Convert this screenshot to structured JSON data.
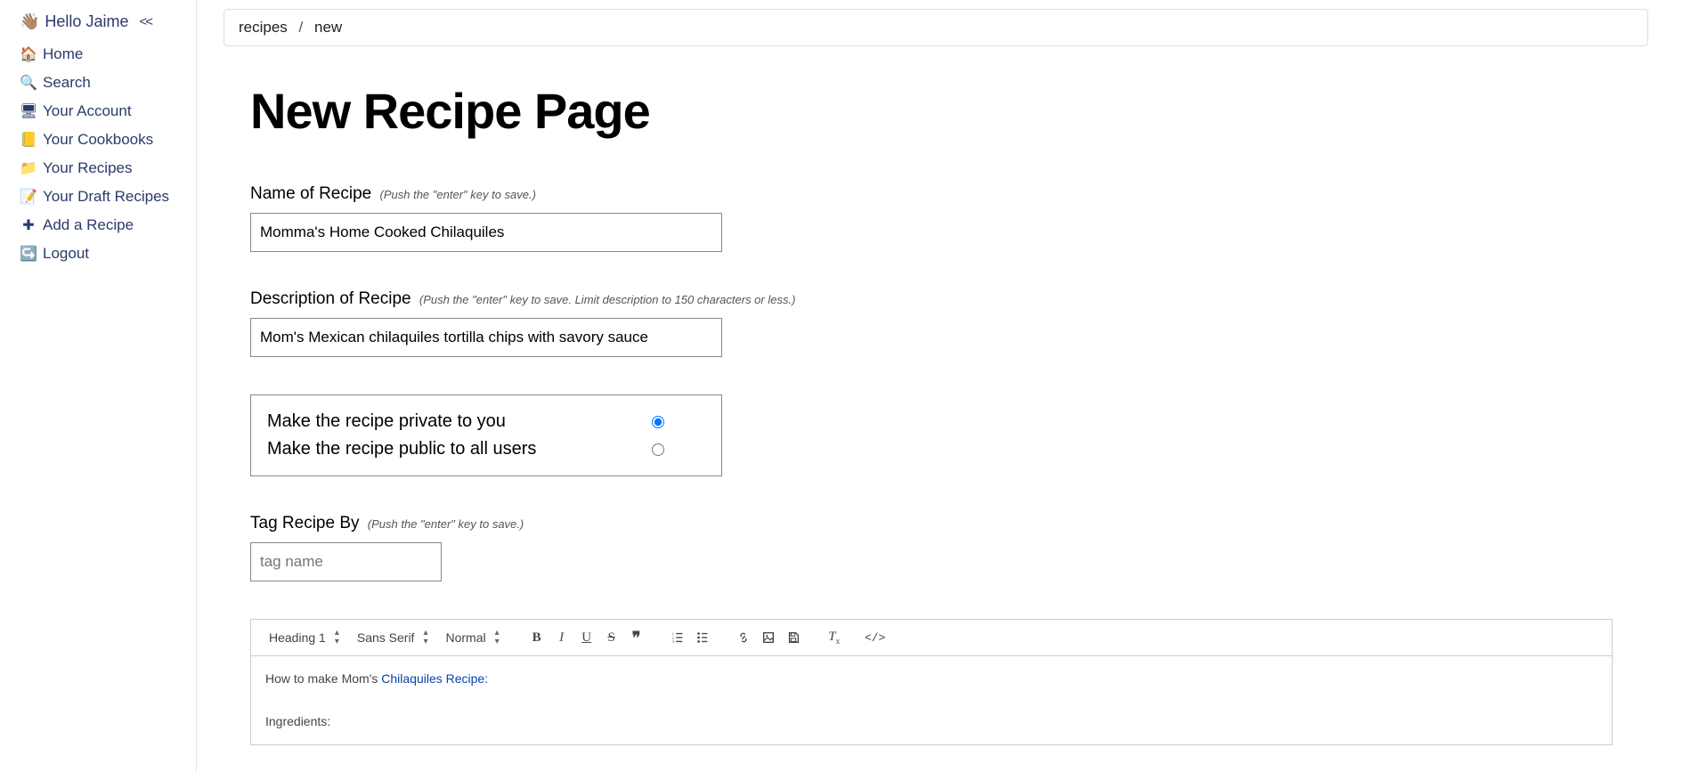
{
  "sidebar": {
    "greeting_icon": "👋🏽",
    "greeting_text": "Hello Jaime",
    "collapse_glyph": "<<",
    "items": [
      {
        "icon": "🏠",
        "label": "Home"
      },
      {
        "icon": "🔍",
        "label": "Search"
      },
      {
        "icon": "🖥",
        "label": "Your Account"
      },
      {
        "icon": "📒",
        "label": "Your Cookbooks"
      },
      {
        "icon": "📁",
        "label": "Your Recipes"
      },
      {
        "icon": "📝",
        "label": "Your Draft Recipes"
      },
      {
        "icon": "✚",
        "label": "Add a Recipe"
      },
      {
        "icon": "↪️",
        "label": "Logout"
      }
    ]
  },
  "breadcrumb": {
    "part1": "recipes",
    "sep": "/",
    "part2": "new"
  },
  "page": {
    "title": "New Recipe Page"
  },
  "form": {
    "name": {
      "label": "Name of Recipe",
      "hint": "(Push the \"enter\" key to save.)",
      "value": "Momma's Home Cooked Chilaquiles"
    },
    "description": {
      "label": "Description of Recipe",
      "hint": "(Push the \"enter\" key to save. Limit description to 150 characters or less.)",
      "value": "Mom's Mexican chilaquiles tortilla chips with savory sauce"
    },
    "visibility": {
      "private_label": "Make the recipe private to you",
      "public_label": "Make the recipe public to all users",
      "selected": "private"
    },
    "tag": {
      "label": "Tag Recipe By",
      "hint": "(Push the \"enter\" key to save.)",
      "placeholder": "tag name"
    }
  },
  "editor": {
    "toolbar": {
      "heading": "Heading 1",
      "font": "Sans Serif",
      "size": "Normal"
    },
    "body": {
      "line1_prefix": "How to make Mom's ",
      "line1_link": "Chilaquiles Recipe:",
      "line2": "Ingredients:"
    }
  }
}
